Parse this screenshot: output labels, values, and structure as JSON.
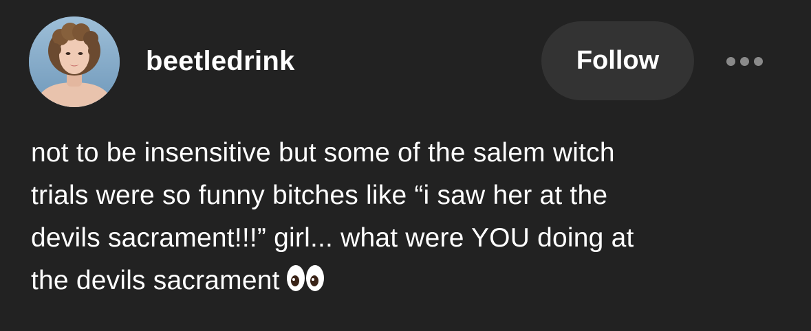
{
  "post": {
    "author": {
      "username": "beetledrink",
      "avatar_icon": "profile-photo"
    },
    "follow_label": "Follow",
    "more_icon": "ellipsis-icon",
    "body_lines": [
      "not to be insensitive but some of the salem witch",
      "trials were so funny bitches like “i saw her at the",
      "devils sacrament!!!” girl... what were YOU doing at",
      "the devils sacrament"
    ],
    "trailing_emoji": "eyes-emoji"
  },
  "colors": {
    "background": "#222222",
    "text": "#ffffff",
    "button_bg": "#333333",
    "more_dots": "#8a8a8a"
  }
}
